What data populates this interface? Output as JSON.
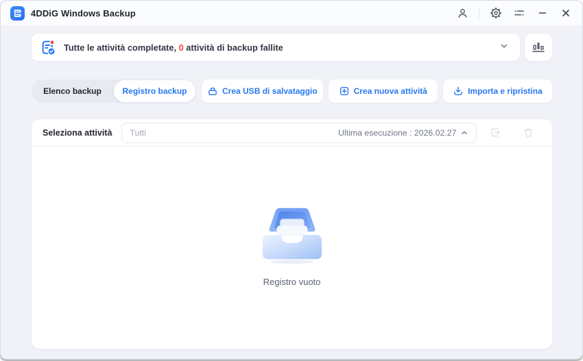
{
  "window": {
    "title": "4DDiG Windows Backup"
  },
  "banner": {
    "prefix": "Tutte le attività completate,",
    "count": "0",
    "suffix": "attività di backup fallite"
  },
  "tabs": {
    "items": [
      {
        "label": "Elenco backup",
        "active": false
      },
      {
        "label": "Registro backup",
        "active": true
      }
    ]
  },
  "actions": {
    "items": [
      {
        "label": "Crea USB di salvataggio",
        "icon": "usb-drive-icon"
      },
      {
        "label": "Crea nuova attività",
        "icon": "plus-square-icon"
      },
      {
        "label": "Importa e ripristina",
        "icon": "import-icon"
      }
    ]
  },
  "filter": {
    "label": "Seleziona attività",
    "value": "Tutti",
    "last_run": "Ultima esecuzione : 2026.02.27"
  },
  "empty": {
    "message": "Registro vuoto"
  },
  "icons": {
    "titlebar": [
      "account-icon",
      "settings-gear-icon",
      "menu-lines-icon",
      "minimize-icon",
      "close-icon"
    ],
    "banner": [
      "task-report-icon",
      "chevron-down-icon",
      "bar-chart-icon"
    ],
    "filter_row": [
      "chevron-up-icon",
      "export-log-icon",
      "delete-log-icon"
    ],
    "empty_state": [
      "empty-tray-illustration"
    ]
  },
  "colors": {
    "accent": "#2878f0",
    "danger": "#f2463c",
    "window_bg": "#f0f2f8",
    "card_bg": "#ffffff",
    "segmented_bg": "#e7eaf1"
  }
}
